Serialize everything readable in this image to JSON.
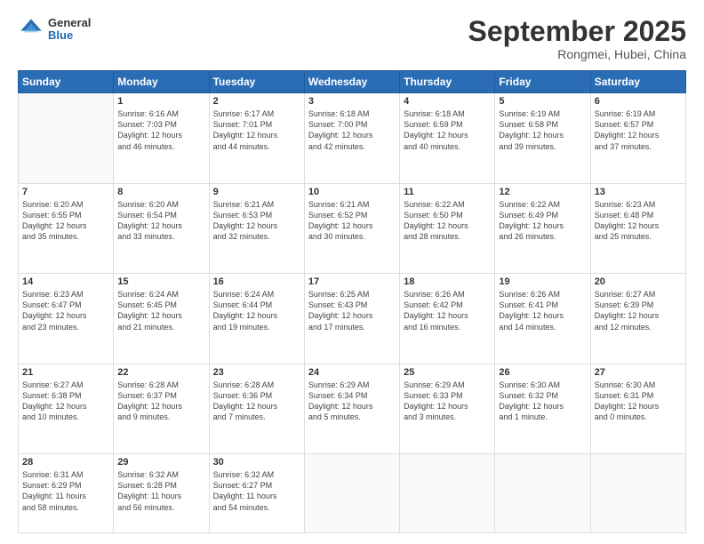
{
  "logo": {
    "general": "General",
    "blue": "Blue"
  },
  "header": {
    "month": "September 2025",
    "location": "Rongmei, Hubei, China"
  },
  "weekdays": [
    "Sunday",
    "Monday",
    "Tuesday",
    "Wednesday",
    "Thursday",
    "Friday",
    "Saturday"
  ],
  "weeks": [
    [
      {
        "day": "",
        "info": ""
      },
      {
        "day": "1",
        "info": "Sunrise: 6:16 AM\nSunset: 7:03 PM\nDaylight: 12 hours\nand 46 minutes."
      },
      {
        "day": "2",
        "info": "Sunrise: 6:17 AM\nSunset: 7:01 PM\nDaylight: 12 hours\nand 44 minutes."
      },
      {
        "day": "3",
        "info": "Sunrise: 6:18 AM\nSunset: 7:00 PM\nDaylight: 12 hours\nand 42 minutes."
      },
      {
        "day": "4",
        "info": "Sunrise: 6:18 AM\nSunset: 6:59 PM\nDaylight: 12 hours\nand 40 minutes."
      },
      {
        "day": "5",
        "info": "Sunrise: 6:19 AM\nSunset: 6:58 PM\nDaylight: 12 hours\nand 39 minutes."
      },
      {
        "day": "6",
        "info": "Sunrise: 6:19 AM\nSunset: 6:57 PM\nDaylight: 12 hours\nand 37 minutes."
      }
    ],
    [
      {
        "day": "7",
        "info": "Sunrise: 6:20 AM\nSunset: 6:55 PM\nDaylight: 12 hours\nand 35 minutes."
      },
      {
        "day": "8",
        "info": "Sunrise: 6:20 AM\nSunset: 6:54 PM\nDaylight: 12 hours\nand 33 minutes."
      },
      {
        "day": "9",
        "info": "Sunrise: 6:21 AM\nSunset: 6:53 PM\nDaylight: 12 hours\nand 32 minutes."
      },
      {
        "day": "10",
        "info": "Sunrise: 6:21 AM\nSunset: 6:52 PM\nDaylight: 12 hours\nand 30 minutes."
      },
      {
        "day": "11",
        "info": "Sunrise: 6:22 AM\nSunset: 6:50 PM\nDaylight: 12 hours\nand 28 minutes."
      },
      {
        "day": "12",
        "info": "Sunrise: 6:22 AM\nSunset: 6:49 PM\nDaylight: 12 hours\nand 26 minutes."
      },
      {
        "day": "13",
        "info": "Sunrise: 6:23 AM\nSunset: 6:48 PM\nDaylight: 12 hours\nand 25 minutes."
      }
    ],
    [
      {
        "day": "14",
        "info": "Sunrise: 6:23 AM\nSunset: 6:47 PM\nDaylight: 12 hours\nand 23 minutes."
      },
      {
        "day": "15",
        "info": "Sunrise: 6:24 AM\nSunset: 6:45 PM\nDaylight: 12 hours\nand 21 minutes."
      },
      {
        "day": "16",
        "info": "Sunrise: 6:24 AM\nSunset: 6:44 PM\nDaylight: 12 hours\nand 19 minutes."
      },
      {
        "day": "17",
        "info": "Sunrise: 6:25 AM\nSunset: 6:43 PM\nDaylight: 12 hours\nand 17 minutes."
      },
      {
        "day": "18",
        "info": "Sunrise: 6:26 AM\nSunset: 6:42 PM\nDaylight: 12 hours\nand 16 minutes."
      },
      {
        "day": "19",
        "info": "Sunrise: 6:26 AM\nSunset: 6:41 PM\nDaylight: 12 hours\nand 14 minutes."
      },
      {
        "day": "20",
        "info": "Sunrise: 6:27 AM\nSunset: 6:39 PM\nDaylight: 12 hours\nand 12 minutes."
      }
    ],
    [
      {
        "day": "21",
        "info": "Sunrise: 6:27 AM\nSunset: 6:38 PM\nDaylight: 12 hours\nand 10 minutes."
      },
      {
        "day": "22",
        "info": "Sunrise: 6:28 AM\nSunset: 6:37 PM\nDaylight: 12 hours\nand 9 minutes."
      },
      {
        "day": "23",
        "info": "Sunrise: 6:28 AM\nSunset: 6:36 PM\nDaylight: 12 hours\nand 7 minutes."
      },
      {
        "day": "24",
        "info": "Sunrise: 6:29 AM\nSunset: 6:34 PM\nDaylight: 12 hours\nand 5 minutes."
      },
      {
        "day": "25",
        "info": "Sunrise: 6:29 AM\nSunset: 6:33 PM\nDaylight: 12 hours\nand 3 minutes."
      },
      {
        "day": "26",
        "info": "Sunrise: 6:30 AM\nSunset: 6:32 PM\nDaylight: 12 hours\nand 1 minute."
      },
      {
        "day": "27",
        "info": "Sunrise: 6:30 AM\nSunset: 6:31 PM\nDaylight: 12 hours\nand 0 minutes."
      }
    ],
    [
      {
        "day": "28",
        "info": "Sunrise: 6:31 AM\nSunset: 6:29 PM\nDaylight: 11 hours\nand 58 minutes."
      },
      {
        "day": "29",
        "info": "Sunrise: 6:32 AM\nSunset: 6:28 PM\nDaylight: 11 hours\nand 56 minutes."
      },
      {
        "day": "30",
        "info": "Sunrise: 6:32 AM\nSunset: 6:27 PM\nDaylight: 11 hours\nand 54 minutes."
      },
      {
        "day": "",
        "info": ""
      },
      {
        "day": "",
        "info": ""
      },
      {
        "day": "",
        "info": ""
      },
      {
        "day": "",
        "info": ""
      }
    ]
  ]
}
